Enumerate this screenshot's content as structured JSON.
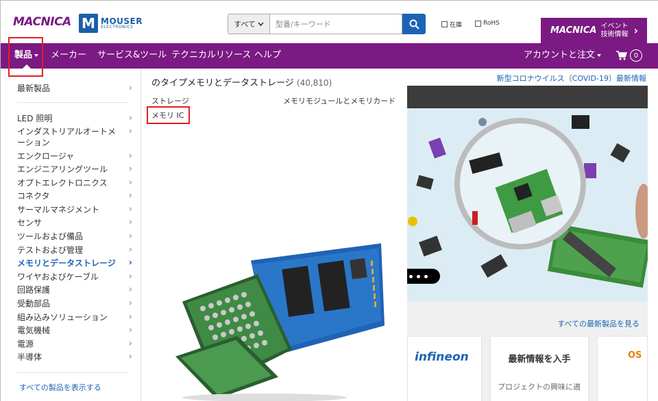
{
  "header": {
    "macnica_logo": "MACNICA",
    "mouser_logo_main": "MOUSER",
    "mouser_logo_sub": "ELECTRONICS",
    "search": {
      "category": "すべて",
      "placeholder": "型番/キーワード"
    },
    "checkbox_stock": "在庫",
    "checkbox_rohs": "RoHS",
    "event": {
      "logo": "MACNICA",
      "line1": "イベント",
      "line2": "技術情報"
    }
  },
  "nav": {
    "products": "製品",
    "manufacturers": "メーカー",
    "services": "サービス&ツール",
    "technical": "テクニカルリソース",
    "help": "ヘルプ",
    "account": "アカウントと注文",
    "cart_count": "0"
  },
  "sidebar": {
    "items": [
      "最新製品",
      "LED 照明",
      "インダストリアルオートメ ーション",
      "エンクロージャ",
      "エンジニアリングツール",
      "オプトエレクトロニクス",
      "コネクタ",
      "サーマルマネジメント",
      "センサ",
      "ツールおよび備品",
      "テストおよび管理",
      "メモリとデータストレージ",
      "ワイヤおよびケーブル",
      "回路保護",
      "受動部品",
      "組み込みソリューション",
      "電気機械",
      "電源",
      "半導体"
    ],
    "active_item": "メモリとデータストレージ",
    "view_all": "すべての製品を表示する"
  },
  "flyout": {
    "title": "のタイプメモリとデータストレージ",
    "count": "(40,810)",
    "links": [
      "ストレージ",
      "メモリモジュールとメモリカード",
      "メモリ IC"
    ],
    "highlighted": "メモリ IC"
  },
  "right": {
    "covid_link": "新型コロナウイルス（COVID-19）最新情報",
    "see_all_new": "すべての最新製品を見る",
    "card1_brand": "infineon",
    "card2_title": "最新情報を入手",
    "card2_sub": "プロジェクトの興味に適",
    "card3_brand": "OS"
  },
  "colors": {
    "brand_purple": "#7b1a83",
    "link_blue": "#1b64b5",
    "highlight_red": "#e31e24"
  }
}
